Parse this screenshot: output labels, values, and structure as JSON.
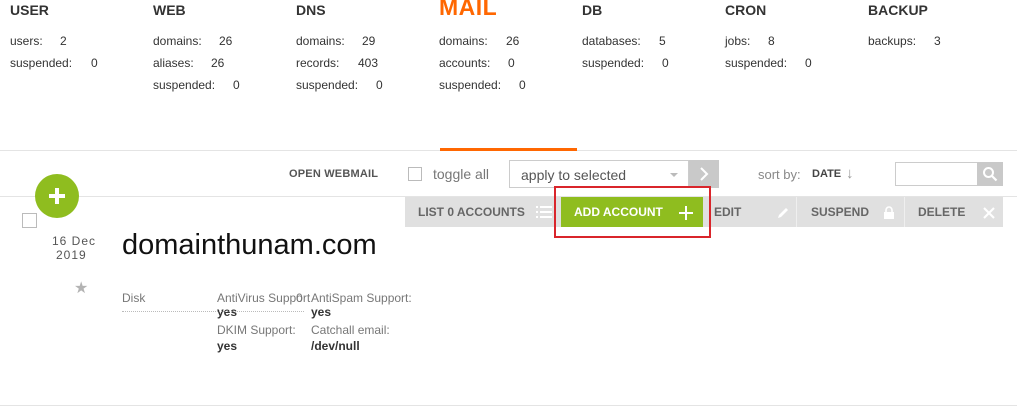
{
  "stats": {
    "user": {
      "title": "USER",
      "rows": [
        {
          "label": "users:",
          "value": "2"
        },
        {
          "label": "suspended:",
          "value": "0"
        }
      ]
    },
    "web": {
      "title": "WEB",
      "rows": [
        {
          "label": "domains:",
          "value": "26"
        },
        {
          "label": "aliases:",
          "value": "26"
        },
        {
          "label": "suspended:",
          "value": "0"
        }
      ]
    },
    "dns": {
      "title": "DNS",
      "rows": [
        {
          "label": "domains:",
          "value": "29"
        },
        {
          "label": "records:",
          "value": "403"
        },
        {
          "label": "suspended:",
          "value": "0"
        }
      ]
    },
    "mail": {
      "title": "MAIL",
      "rows": [
        {
          "label": "domains:",
          "value": "26"
        },
        {
          "label": "accounts:",
          "value": "0"
        },
        {
          "label": "suspended:",
          "value": "0"
        }
      ]
    },
    "db": {
      "title": "DB",
      "rows": [
        {
          "label": "databases:",
          "value": "5"
        },
        {
          "label": "suspended:",
          "value": "0"
        }
      ]
    },
    "cron": {
      "title": "CRON",
      "rows": [
        {
          "label": "jobs:",
          "value": "8"
        },
        {
          "label": "suspended:",
          "value": "0"
        }
      ]
    },
    "backup": {
      "title": "BACKUP",
      "rows": [
        {
          "label": "backups:",
          "value": "3"
        }
      ]
    }
  },
  "toolbar": {
    "open_webmail": "OPEN WEBMAIL",
    "toggle_all": "toggle all",
    "apply_selected": "apply to selected",
    "sort_by": "sort by:",
    "sort_value": "DATE",
    "sort_arrow": "↓",
    "search_placeholder": ""
  },
  "actions": {
    "list": "LIST 0 ACCOUNTS",
    "add": "ADD ACCOUNT",
    "edit": "EDIT",
    "suspend": "SUSPEND",
    "delete": "DELETE"
  },
  "row": {
    "date_day": "16 Dec",
    "date_year": "2019",
    "star": "★",
    "domain": "domainthunam.com",
    "disk_label": "Disk",
    "antivirus_label": "AntiVirus Support:",
    "antivirus_value": "yes",
    "antispam_label": "AntiSpam Support:",
    "antispam_value": "yes",
    "dkim_label": "DKIM Support:",
    "dkim_value": "yes",
    "catchall_label": "Catchall email:",
    "catchall_value": "/dev/null",
    "disk_value": "0"
  },
  "colors": {
    "accent": "#ff6701",
    "green": "#8fbd1f",
    "highlight": "#d9252b"
  }
}
